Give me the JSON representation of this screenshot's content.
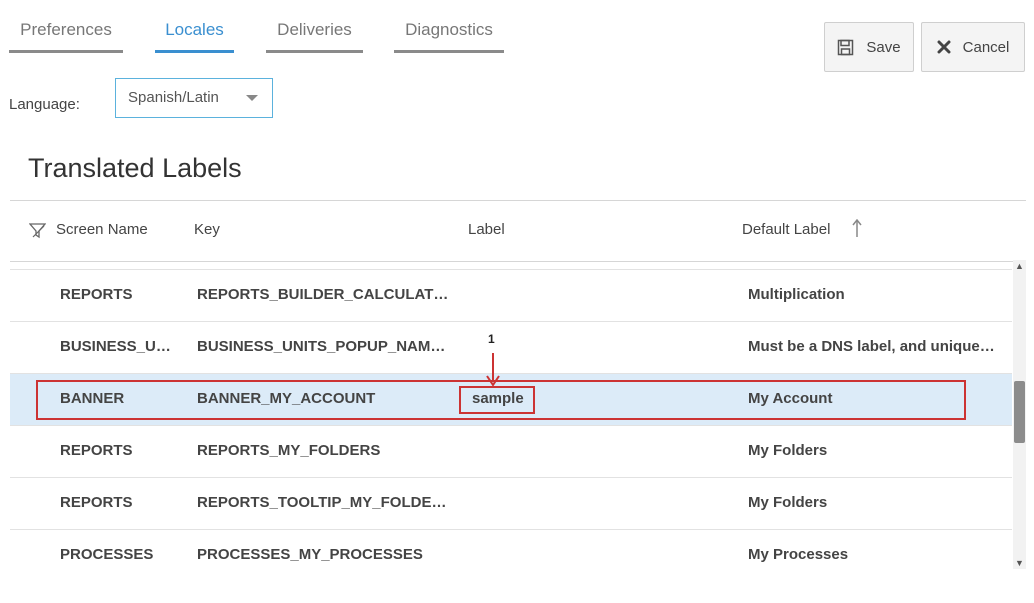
{
  "tabs": [
    {
      "label": "Preferences",
      "active": false
    },
    {
      "label": "Locales",
      "active": true
    },
    {
      "label": "Deliveries",
      "active": false
    },
    {
      "label": "Diagnostics",
      "active": false
    }
  ],
  "toolbar": {
    "save_label": "Save",
    "cancel_label": "Cancel",
    "save_icon": "floppy-disk-icon",
    "cancel_icon": "x-icon"
  },
  "language": {
    "label": "Language:",
    "selected": "Spanish/Latin"
  },
  "section_title": "Translated Labels",
  "table": {
    "headers": {
      "screen_name": "Screen Name",
      "key": "Key",
      "label": "Label",
      "default_label": "Default Label"
    },
    "sort": {
      "column": "Default Label",
      "direction": "ascending"
    },
    "rows": [
      {
        "screen": "REPORTS",
        "key": "REPORTS_BUILDER_CALCULAT…",
        "label": "",
        "default": "Multiplication"
      },
      {
        "screen": "BUSINESS_U…",
        "key": "BUSINESS_UNITS_POPUP_NAM…",
        "label": "",
        "default": "Must be a DNS label, and unique…"
      },
      {
        "screen": "BANNER",
        "key": "BANNER_MY_ACCOUNT",
        "label": "sample",
        "default": "My Account",
        "selected": true
      },
      {
        "screen": "REPORTS",
        "key": "REPORTS_MY_FOLDERS",
        "label": "",
        "default": "My Folders"
      },
      {
        "screen": "REPORTS",
        "key": "REPORTS_TOOLTIP_MY_FOLDE…",
        "label": "",
        "default": "My Folders"
      },
      {
        "screen": "PROCESSES",
        "key": "PROCESSES_MY_PROCESSES",
        "label": "",
        "default": "My Processes"
      }
    ]
  },
  "annotation": {
    "number": "1",
    "color": "#cc3333"
  },
  "colors": {
    "accent": "#3a8fd0",
    "selected_row": "#dcebf8",
    "annotation": "#cc3333"
  }
}
